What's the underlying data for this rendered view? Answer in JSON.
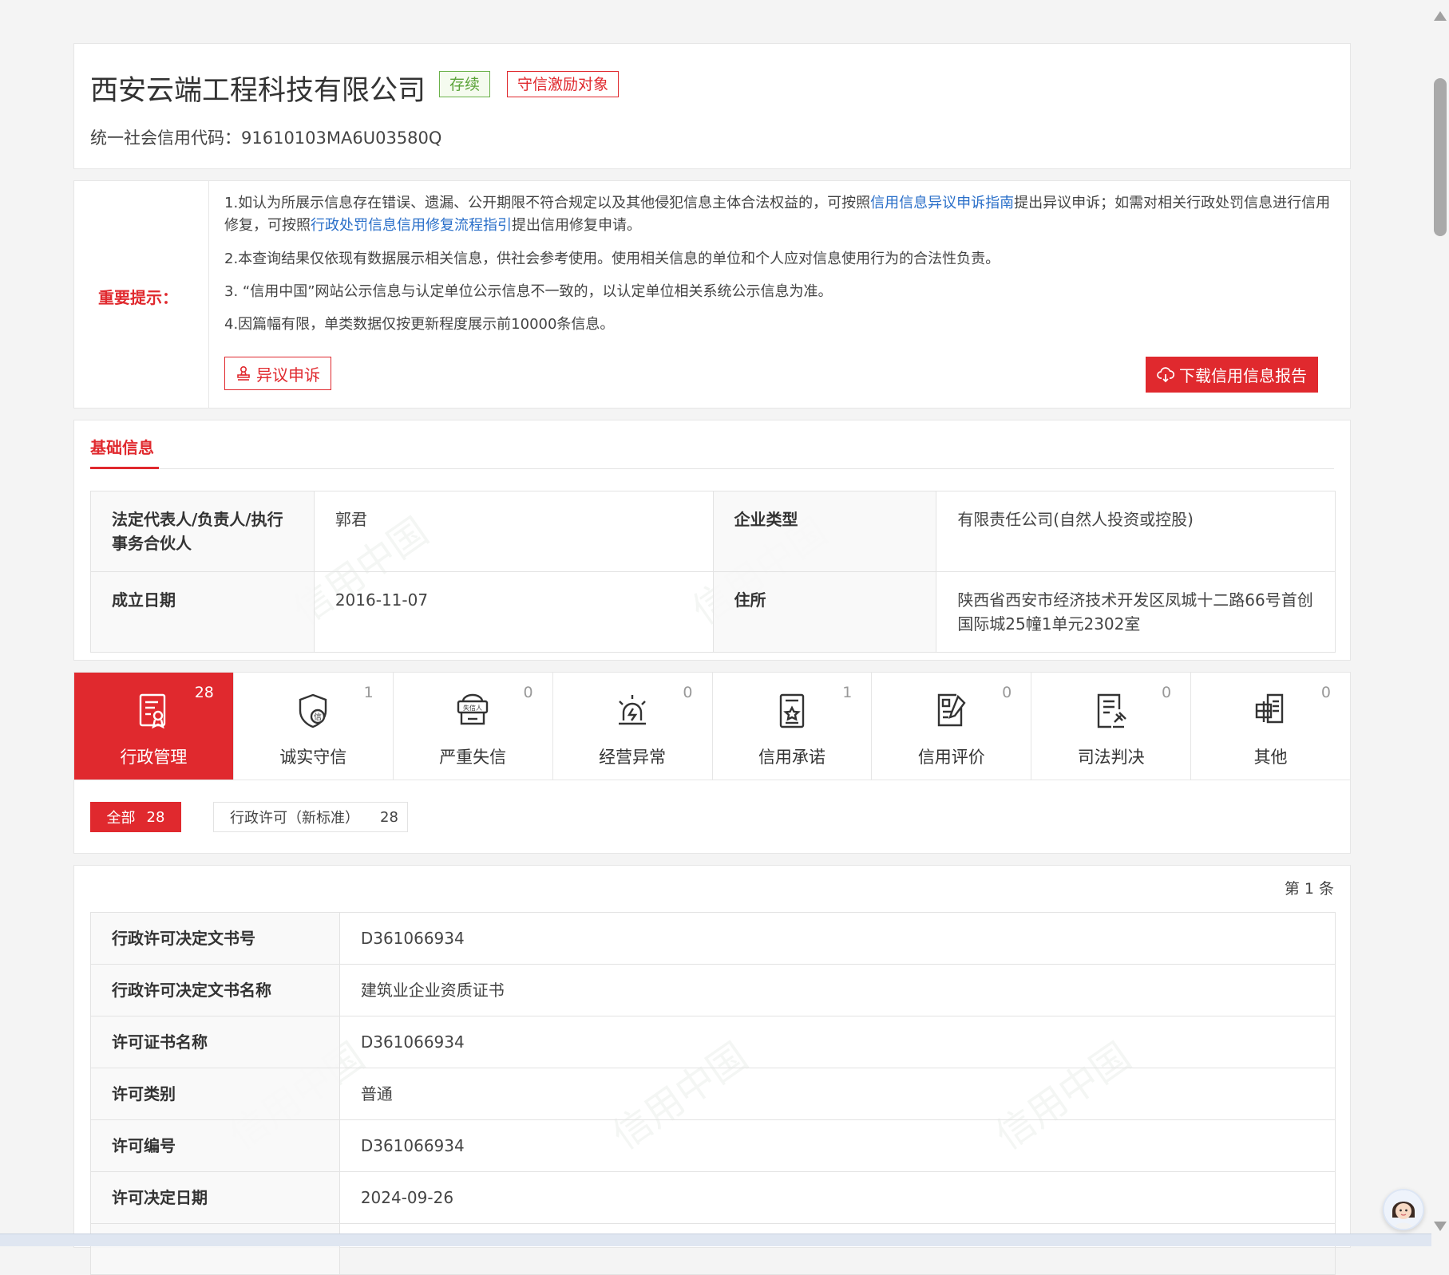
{
  "company": {
    "name": "西安云端工程科技有限公司",
    "status_tag": "存续",
    "honor_tag": "守信激励对象",
    "credit_code_label": "统一社会信用代码：",
    "credit_code": "91610103MA6U03580Q"
  },
  "notice": {
    "title": "重要提示：",
    "line1_pre": "1.如认为所展示信息存在错误、遗漏、公开期限不符合规定以及其他侵犯信息主体合法权益的，可按照",
    "line1_link1": "信用信息异议申诉指南",
    "line1_mid": "提出异议申诉；如需对相关行政处罚信息进行信用修复，可按照",
    "line1_link2": "行政处罚信息信用修复流程指引",
    "line1_post": "提出信用修复申请。",
    "line2": "2.本查询结果仅依现有数据展示相关信息，供社会参考使用。使用相关信息的单位和个人应对信息使用行为的合法性负责。",
    "line3": "3. “信用中国”网站公示信息与认定单位公示信息不一致的，以认定单位相关系统公示信息为准。",
    "line4": "4.因篇幅有限，单类数据仅按更新程度展示前10000条信息。",
    "appeal_button": "异议申诉",
    "download_button": "下载信用信息报告"
  },
  "basic_info": {
    "title": "基础信息",
    "rows": [
      {
        "label1": "法定代表人/负责人/执行事务合伙人",
        "value1": "郭君",
        "label2": "企业类型",
        "value2": "有限责任公司(自然人投资或控股)"
      },
      {
        "label1": "成立日期",
        "value1": "2016-11-07",
        "label2": "住所",
        "value2": "陕西省西安市经济技术开发区凤城十二路66号首创国际城25幢1单元2302室"
      }
    ]
  },
  "tabs": [
    {
      "label": "行政管理",
      "count": "28",
      "icon": "admin-doc-icon"
    },
    {
      "label": "诚实守信",
      "count": "1",
      "icon": "honesty-shield-icon"
    },
    {
      "label": "严重失信",
      "count": "0",
      "icon": "dishonest-person-icon"
    },
    {
      "label": "经营异常",
      "count": "0",
      "icon": "alarm-light-icon"
    },
    {
      "label": "信用承诺",
      "count": "1",
      "icon": "promise-star-icon"
    },
    {
      "label": "信用评价",
      "count": "0",
      "icon": "evaluation-edit-icon"
    },
    {
      "label": "司法判决",
      "count": "0",
      "icon": "judgment-gavel-icon"
    },
    {
      "label": "其他",
      "count": "0",
      "icon": "other-docs-icon"
    }
  ],
  "filters": {
    "all_label": "全部",
    "all_count": "28",
    "license_label": "行政许可（新标准）",
    "license_count": "28"
  },
  "record": {
    "counter": "第 1 条",
    "rows": [
      {
        "label": "行政许可决定文书号",
        "value": "D361066934"
      },
      {
        "label": "行政许可决定文书名称",
        "value": "建筑业企业资质证书"
      },
      {
        "label": "许可证书名称",
        "value": "D361066934"
      },
      {
        "label": "许可类别",
        "value": "普通"
      },
      {
        "label": "许可编号",
        "value": "D361066934"
      },
      {
        "label": "许可决定日期",
        "value": "2024-09-26"
      }
    ]
  },
  "watermark": "信用中国",
  "colors": {
    "brand_red": "#e0292e",
    "status_green": "#5ba33a",
    "link_blue": "#2a6fc9"
  }
}
